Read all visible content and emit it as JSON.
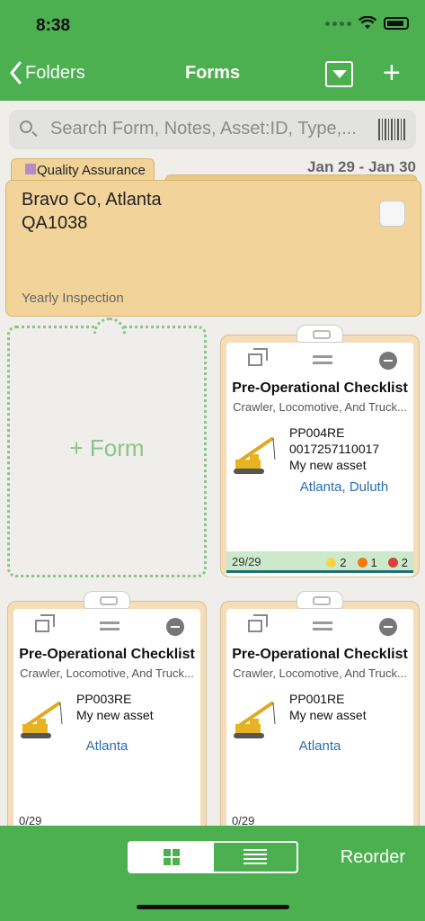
{
  "status": {
    "time": "8:38"
  },
  "nav": {
    "back_label": "Folders",
    "title": "Forms"
  },
  "search": {
    "placeholder": "Search Form, Notes, Asset:ID, Type,..."
  },
  "folder": {
    "tab_label": "Quality Assurance",
    "tab_color": "#b58cc6",
    "date_range": "Jan 29 - Jan 30",
    "title": "Bravo Co, Atlanta",
    "code": "QA1038",
    "footer": "Yearly Inspection"
  },
  "add_form": {
    "label": "+ Form"
  },
  "forms": [
    {
      "title": "Pre-Operational Checklist",
      "subtitle": "Crawler, Locomotive, And Truck...",
      "id": "PP004RE",
      "line2": "0017257110017",
      "line3": "My new asset",
      "location": "Atlanta, Duluth",
      "count": "29/29",
      "pills": [
        {
          "color": "#f4d44b",
          "value": "2"
        },
        {
          "color": "#f07c12",
          "value": "1"
        },
        {
          "color": "#d9413a",
          "value": "2"
        }
      ]
    },
    {
      "title": "Pre-Operational Checklist",
      "subtitle": "Crawler, Locomotive, And Truck...",
      "id": "PP003RE",
      "line2": "My new asset",
      "location": "Atlanta",
      "count": "0/29"
    },
    {
      "title": "Pre-Operational Checklist",
      "subtitle": "Crawler, Locomotive, And Truck...",
      "id": "PP001RE",
      "line2": "My new asset",
      "location": "Atlanta",
      "count": "0/29"
    }
  ],
  "toolbar": {
    "reorder_label": "Reorder"
  },
  "colors": {
    "accent": "#4caf50",
    "link": "#2a6db2",
    "folder": "#f2d39a"
  }
}
